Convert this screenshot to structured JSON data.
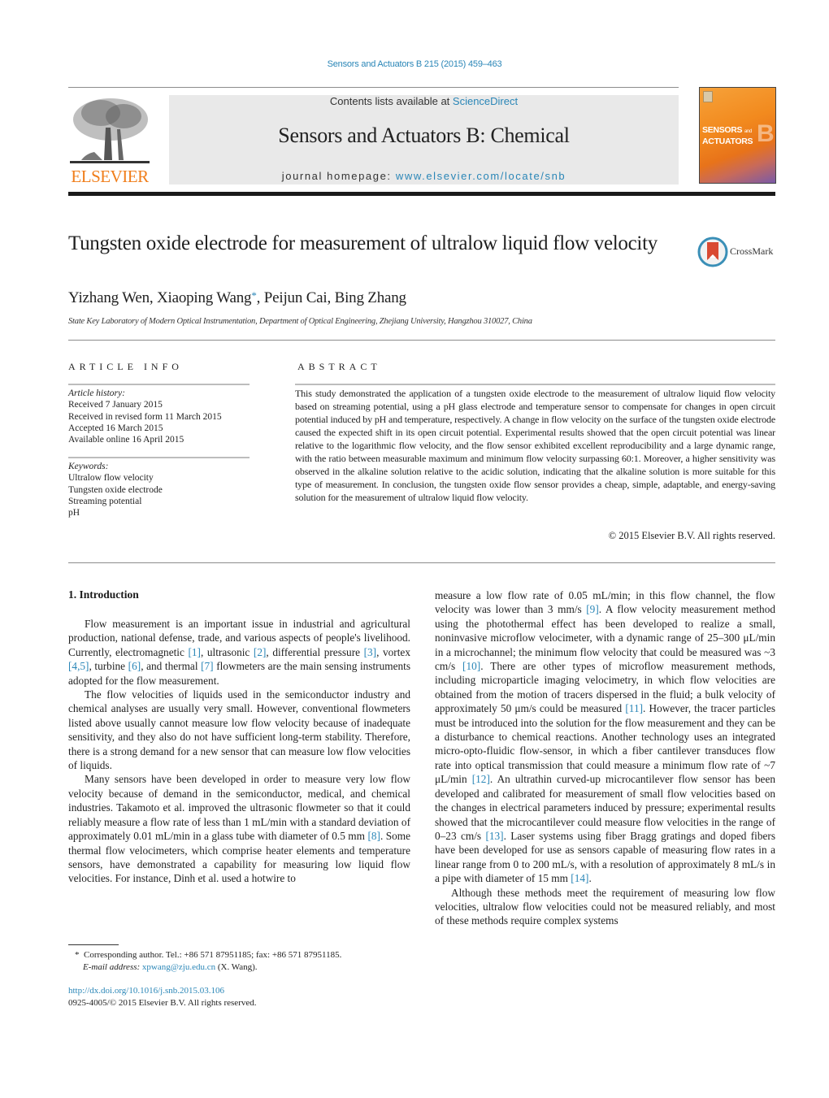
{
  "header": {
    "journal_ref": "Sensors and Actuators B 215 (2015) 459–463",
    "contents_prefix": "Contents lists available at ",
    "contents_link": "ScienceDirect",
    "journal_title": "Sensors and Actuators B: Chemical",
    "homepage_prefix": "journal homepage: ",
    "homepage_link": "www.elsevier.com/locate/snb",
    "publisher_logo_text": "ELSEVIER",
    "cover": {
      "line1": "SENSORS",
      "line1_small": "and",
      "line2": "ACTUATORS",
      "letter": "B"
    },
    "colors": {
      "link": "#2a86b7",
      "elsevier_orange": "#f07e1b",
      "banner_bg": "#e9e9e9"
    }
  },
  "article": {
    "title": "Tungsten oxide electrode for measurement of ultralow liquid flow velocity",
    "crossmark_label": "CrossMark",
    "authors": [
      {
        "name": "Yizhang Wen",
        "sep": ", "
      },
      {
        "name": "Xiaoping Wang",
        "mark": "*",
        "sep": ", "
      },
      {
        "name": "Peijun Cai",
        "sep": ", "
      },
      {
        "name": "Bing Zhang",
        "sep": ""
      }
    ],
    "affiliation": "State Key Laboratory of Modern Optical Instrumentation, Department of Optical Engineering, Zhejiang University, Hangzhou 310027, China"
  },
  "article_info": {
    "caption": "ARTICLE INFO",
    "history_label": "Article history:",
    "history": [
      "Received 7 January 2015",
      "Received in revised form 11 March 2015",
      "Accepted 16 March 2015",
      "Available online 16 April 2015"
    ],
    "keywords_label": "Keywords:",
    "keywords": [
      "Ultralow flow velocity",
      "Tungsten oxide electrode",
      "Streaming potential",
      "pH"
    ]
  },
  "abstract": {
    "caption": "ABSTRACT",
    "text": "This study demonstrated the application of a tungsten oxide electrode to the measurement of ultralow liquid flow velocity based on streaming potential, using a pH glass electrode and temperature sensor to compensate for changes in open circuit potential induced by pH and temperature, respectively. A change in flow velocity on the surface of the tungsten oxide electrode caused the expected shift in its open circuit potential. Experimental results showed that the open circuit potential was linear relative to the logarithmic flow velocity, and the flow sensor exhibited excellent reproducibility and a large dynamic range, with the ratio between measurable maximum and minimum flow velocity surpassing 60:1. Moreover, a higher sensitivity was observed in the alkaline solution relative to the acidic solution, indicating that the alkaline solution is more suitable for this type of measurement. In conclusion, the tungsten oxide flow sensor provides a cheap, simple, adaptable, and energy-saving solution for the measurement of ultralow liquid flow velocity.",
    "copyright": "© 2015 Elsevier B.V. All rights reserved."
  },
  "body": {
    "section_heading": "1.  Introduction",
    "paragraphs": [
      {
        "col": "left",
        "segments": [
          {
            "t": "Flow measurement is an important issue in industrial and agricultural production, national defense, trade, and various aspects of people's livelihood. Currently, electromagnetic "
          },
          {
            "ref": "[1]"
          },
          {
            "t": ", ultrasonic "
          },
          {
            "ref": "[2]"
          },
          {
            "t": ", differential pressure "
          },
          {
            "ref": "[3]"
          },
          {
            "t": ", vortex "
          },
          {
            "ref": "[4,5]"
          },
          {
            "t": ", turbine "
          },
          {
            "ref": "[6]"
          },
          {
            "t": ", and thermal "
          },
          {
            "ref": "[7]"
          },
          {
            "t": " flowmeters are the main sensing instruments adopted for the flow measurement."
          }
        ]
      },
      {
        "col": "left",
        "segments": [
          {
            "t": "The flow velocities of liquids used in the semiconductor industry and chemical analyses are usually very small. However, conventional flowmeters listed above usually cannot measure low flow velocity because of inadequate sensitivity, and they also do not have sufficient long-term stability. Therefore, there is a strong demand for a new sensor that can measure low flow velocities of liquids."
          }
        ]
      },
      {
        "col": "left",
        "segments": [
          {
            "t": "Many sensors have been developed in order to measure very low flow velocity because of demand in the semiconductor, medical, and chemical industries. Takamoto et al. improved the ultrasonic flowmeter so that it could reliably measure a flow rate of less than 1 mL/min with a standard deviation of approximately 0.01 mL/min in a glass tube with diameter of 0.5 mm "
          },
          {
            "ref": "[8]"
          },
          {
            "t": ". Some thermal flow velocimeters, which comprise heater elements and temperature sensors, have demonstrated a capability for measuring low liquid flow velocities. For instance, Dinh et al. used a hotwire to"
          }
        ]
      },
      {
        "col": "right",
        "noindent": true,
        "segments": [
          {
            "t": "measure a low flow rate of 0.05 mL/min; in this flow channel, the flow velocity was lower than 3 mm/s "
          },
          {
            "ref": "[9]"
          },
          {
            "t": ". A flow velocity measurement method using the photothermal effect has been developed to realize a small, noninvasive microflow velocimeter, with a dynamic range of 25–300 μL/min in a microchannel; the minimum flow velocity that could be measured was ~3 cm/s "
          },
          {
            "ref": "[10]"
          },
          {
            "t": ". There are other types of microflow measurement methods, including microparticle imaging velocimetry, in which flow velocities are obtained from the motion of tracers dispersed in the fluid; a bulk velocity of approximately 50 μm/s could be measured "
          },
          {
            "ref": "[11]"
          },
          {
            "t": ". However, the tracer particles must be introduced into the solution for the flow measurement and they can be a disturbance to chemical reactions. Another technology uses an integrated micro-opto-fluidic flow-sensor, in which a fiber cantilever transduces flow rate into optical transmission that could measure a minimum flow rate of ~7 μL/min "
          },
          {
            "ref": "[12]"
          },
          {
            "t": ". An ultrathin curved-up microcantilever flow sensor has been developed and calibrated for measurement of small flow velocities based on the changes in electrical parameters induced by pressure; experimental results showed that the microcantilever could measure flow velocities in the range of 0–23 cm/s "
          },
          {
            "ref": "[13]"
          },
          {
            "t": ". Laser systems using fiber Bragg gratings and doped fibers have been developed for use as sensors capable of measuring flow rates in a linear range from 0 to 200 mL/s, with a resolution of approximately 8 mL/s in a pipe with diameter of 15 mm "
          },
          {
            "ref": "[14]"
          },
          {
            "t": "."
          }
        ]
      },
      {
        "col": "right",
        "segments": [
          {
            "t": "Although these methods meet the requirement of measuring low flow velocities, ultralow flow velocities could not be measured reliably, and most of these methods require complex systems"
          }
        ]
      }
    ]
  },
  "footnote": {
    "mark": "*",
    "corresponding": "Corresponding author. Tel.: +86 571 87951185; fax: +86 571 87951185.",
    "email_label": "E-mail address: ",
    "email": "xpwang@zju.edu.cn",
    "email_suffix": " (X. Wang).",
    "doi": "http://dx.doi.org/10.1016/j.snb.2015.03.106",
    "issn_line": "0925-4005/© 2015 Elsevier B.V. All rights reserved."
  }
}
